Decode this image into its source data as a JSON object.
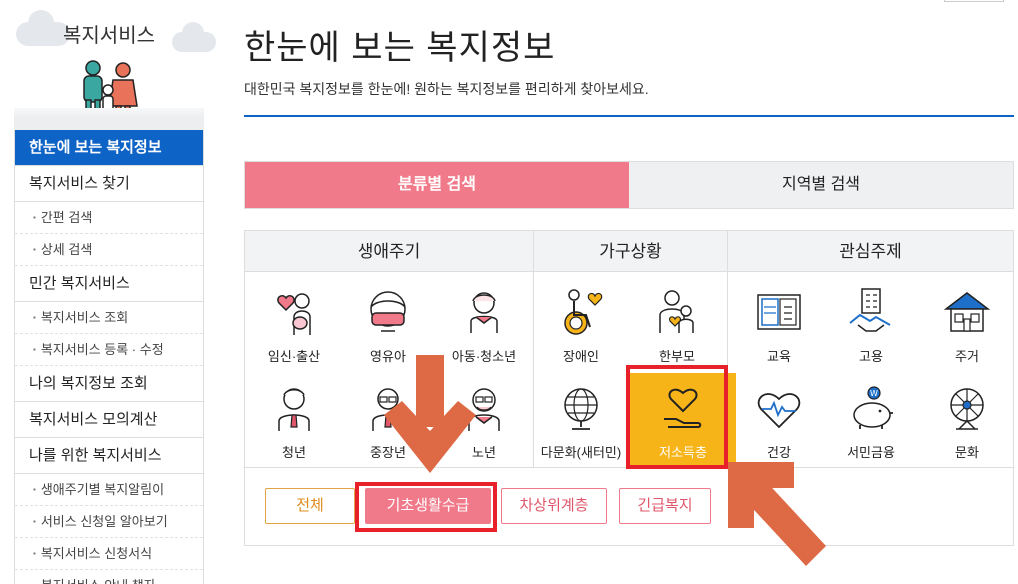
{
  "sidebar": {
    "title": "복지서비스",
    "items": [
      {
        "label": "한눈에 보는 복지정보",
        "type": "main",
        "active": true
      },
      {
        "label": "복지서비스 찾기",
        "type": "main"
      },
      {
        "label": "간편 검색",
        "type": "sub"
      },
      {
        "label": "상세 검색",
        "type": "sub"
      },
      {
        "label": "민간 복지서비스",
        "type": "main"
      },
      {
        "label": "복지서비스 조회",
        "type": "sub"
      },
      {
        "label": "복지서비스 등록 · 수정",
        "type": "sub"
      },
      {
        "label": "나의 복지정보 조회",
        "type": "main"
      },
      {
        "label": "복지서비스 모의계산",
        "type": "main"
      },
      {
        "label": "나를 위한 복지서비스",
        "type": "main"
      },
      {
        "label": "생애주기별 복지알림이",
        "type": "sub"
      },
      {
        "label": "서비스 신청일 알아보기",
        "type": "sub"
      },
      {
        "label": "복지서비스 신청서식",
        "type": "sub"
      },
      {
        "label": "복지서비스 안내 책자",
        "type": "sub"
      }
    ]
  },
  "header": {
    "title": "한눈에 보는 복지정보",
    "description": "대한민국 복지정보를 한눈에! 원하는 복지정보를 편리하게 찾아보세요."
  },
  "tabs": [
    {
      "label": "분류별 검색",
      "active": true
    },
    {
      "label": "지역별 검색",
      "active": false
    }
  ],
  "groups": [
    {
      "title": "생애주기",
      "items": [
        {
          "label": "임신·출산",
          "icon": "pregnancy-icon"
        },
        {
          "label": "영유아",
          "icon": "infant-icon"
        },
        {
          "label": "아동·청소년",
          "icon": "child-icon"
        },
        {
          "label": "청년",
          "icon": "youth-icon"
        },
        {
          "label": "중장년",
          "icon": "middle-aged-icon"
        },
        {
          "label": "노년",
          "icon": "elderly-icon"
        }
      ]
    },
    {
      "title": "가구상황",
      "items": [
        {
          "label": "장애인",
          "icon": "disabled-icon"
        },
        {
          "label": "한부모",
          "icon": "single-parent-icon"
        },
        {
          "label": "다문화(새터민)",
          "icon": "multicultural-icon"
        },
        {
          "label": "저소득층",
          "icon": "low-income-icon",
          "selected": true
        }
      ]
    },
    {
      "title": "관심주제",
      "items": [
        {
          "label": "교육",
          "icon": "education-icon"
        },
        {
          "label": "고용",
          "icon": "employment-icon"
        },
        {
          "label": "주거",
          "icon": "housing-icon"
        },
        {
          "label": "건강",
          "icon": "health-icon"
        },
        {
          "label": "서민금융",
          "icon": "finance-icon"
        },
        {
          "label": "문화",
          "icon": "culture-icon"
        }
      ]
    }
  ],
  "filters": [
    {
      "label": "전체"
    },
    {
      "label": "기초생활수급",
      "active": true
    },
    {
      "label": "차상위계층"
    },
    {
      "label": "긴급복지"
    }
  ],
  "colors": {
    "accent_blue": "#0e63c6",
    "tab_pink": "#f07a8a",
    "selected_yellow": "#f7b418",
    "annotation_red": "#e8202a",
    "annotation_arrow": "#de6a45"
  }
}
